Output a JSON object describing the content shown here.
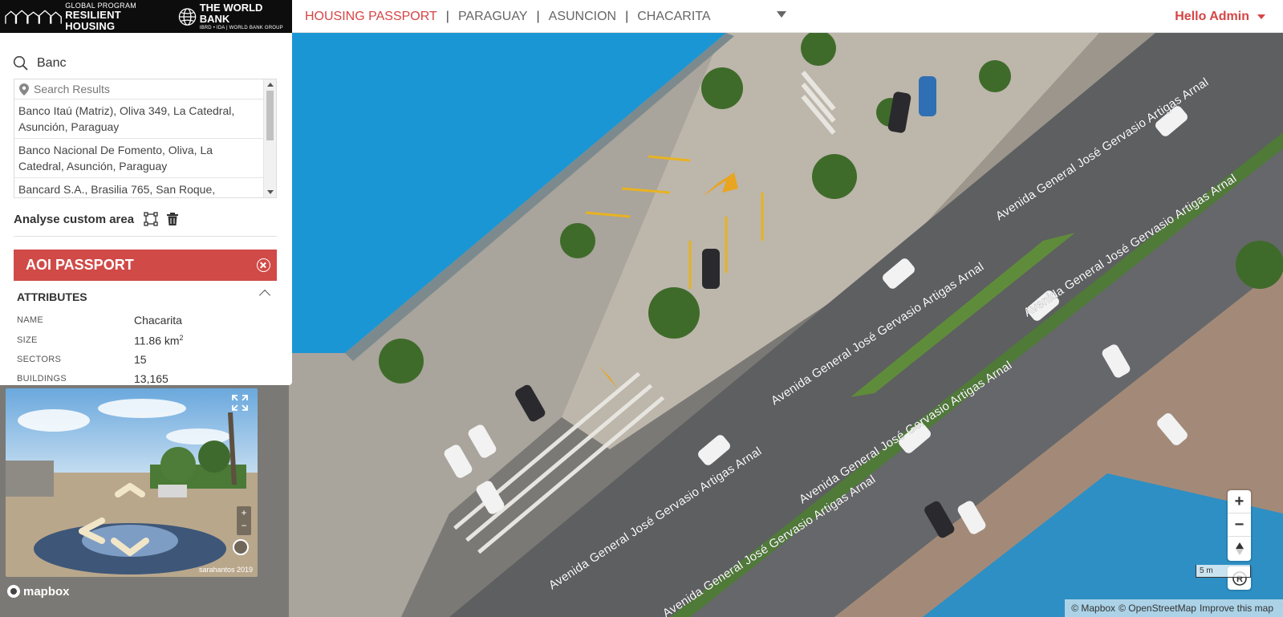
{
  "header": {
    "logo_program_small": "GLOBAL PROGRAM",
    "logo_program_big": "RESILIENT HOUSING",
    "logo_wb_title": "THE WORLD BANK",
    "logo_wb_sub": "IBRD • IDA | WORLD BANK GROUP",
    "breadcrumb": [
      "HOUSING PASSPORT",
      "PARAGUAY",
      "ASUNCION",
      "CHACARITA"
    ],
    "separator": "|",
    "user_greeting": "Hello Admin"
  },
  "search": {
    "value": "Banc",
    "results_placeholder": "Search Results",
    "results": [
      "Banco Itaú (Matriz), Oliva 349, La Catedral, Asunción, Paraguay",
      "Banco Nacional De Fomento, Oliva, La Catedral, Asunción, Paraguay",
      "Bancard S.A., Brasilia 765, San Roque,"
    ]
  },
  "custom_area": {
    "label": "Analyse custom area"
  },
  "aoi": {
    "title": "AOI PASSPORT",
    "attributes_title": "ATTRIBUTES",
    "attributes": [
      {
        "key": "NAME",
        "value": "Chacarita"
      },
      {
        "key": "SIZE",
        "value": "11.86 km",
        "sup": "2"
      },
      {
        "key": "SECTORS",
        "value": "15"
      },
      {
        "key": "BUILDINGS",
        "value": "13,165"
      }
    ]
  },
  "streetview": {
    "credit": "sarahantos 2019"
  },
  "map": {
    "road_name": "Avenida General José Gervasio Artigas Arnal",
    "scale_label": "5 m",
    "attribution": [
      "© Mapbox",
      "© OpenStreetMap",
      "Improve this map"
    ],
    "mapbox_logo": "mapbox",
    "zoom_in": "+",
    "zoom_out": "−"
  },
  "colors": {
    "accent": "#d64545",
    "aoi_header": "#d04a47",
    "building_roof": "#1b96d4"
  }
}
